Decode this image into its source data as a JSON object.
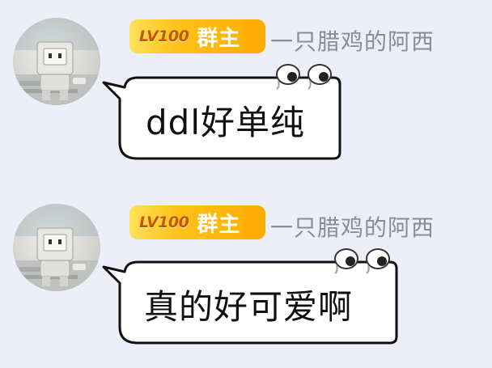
{
  "messages": [
    {
      "sender": {
        "level": "LV100",
        "role": "群主",
        "nickname": "一只腊鸡的阿西"
      },
      "text": "ddl好单纯"
    },
    {
      "sender": {
        "level": "LV100",
        "role": "群主",
        "nickname": "一只腊鸡的阿西"
      },
      "text": "真的好可爱啊"
    }
  ],
  "colors": {
    "background": "#eceef8",
    "badge_gradient": [
      "#ffe25a",
      "#ffab00"
    ],
    "nickname": "#8a8c97",
    "bubble_fill": "#ffffff",
    "bubble_outline": "#111111"
  },
  "icons": [
    "avatar-robot",
    "googly-eyes-icon"
  ]
}
